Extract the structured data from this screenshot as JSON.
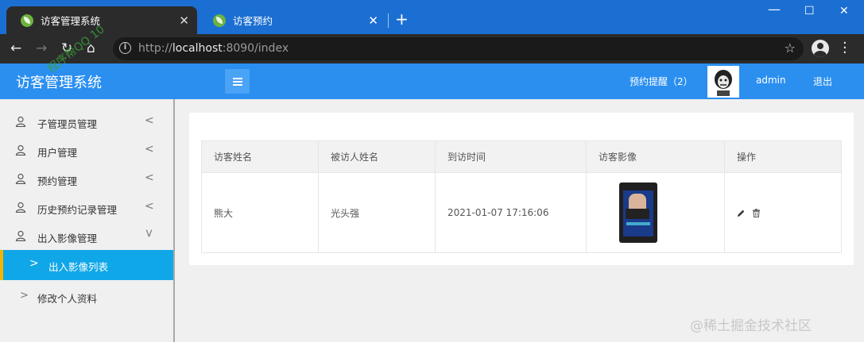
{
  "browser": {
    "tabs": [
      {
        "title": "访客管理系统",
        "active": true
      },
      {
        "title": "访客预约",
        "active": false
      }
    ],
    "url_prefix": "http://",
    "url_host": "localhost",
    "url_rest": ":8090/index"
  },
  "header": {
    "brand": "访客管理系统",
    "reminder": "预约提醒（2）",
    "username": "admin",
    "logout": "退出"
  },
  "sidebar": {
    "items": [
      {
        "label": "子管理员管理"
      },
      {
        "label": "用户管理"
      },
      {
        "label": "预约管理"
      },
      {
        "label": "历史预约记录管理"
      },
      {
        "label": "出入影像管理"
      },
      {
        "label": "出入影像列表"
      },
      {
        "label": "修改个人资料"
      }
    ]
  },
  "watermark": "程序帮QQ 10  ",
  "table": {
    "headers": [
      "访客姓名",
      "被访人姓名",
      "到访时间",
      "访客影像",
      "操作"
    ],
    "rows": [
      {
        "visitor": "熊大",
        "host": "光头强",
        "time": "2021-01-07 17:16:06"
      }
    ]
  },
  "corner_watermark": "@稀土掘金技术社区",
  "colors": {
    "header": "#2b8ff0",
    "active_menu": "#10a7e8",
    "active_bar": "#f5b400"
  }
}
